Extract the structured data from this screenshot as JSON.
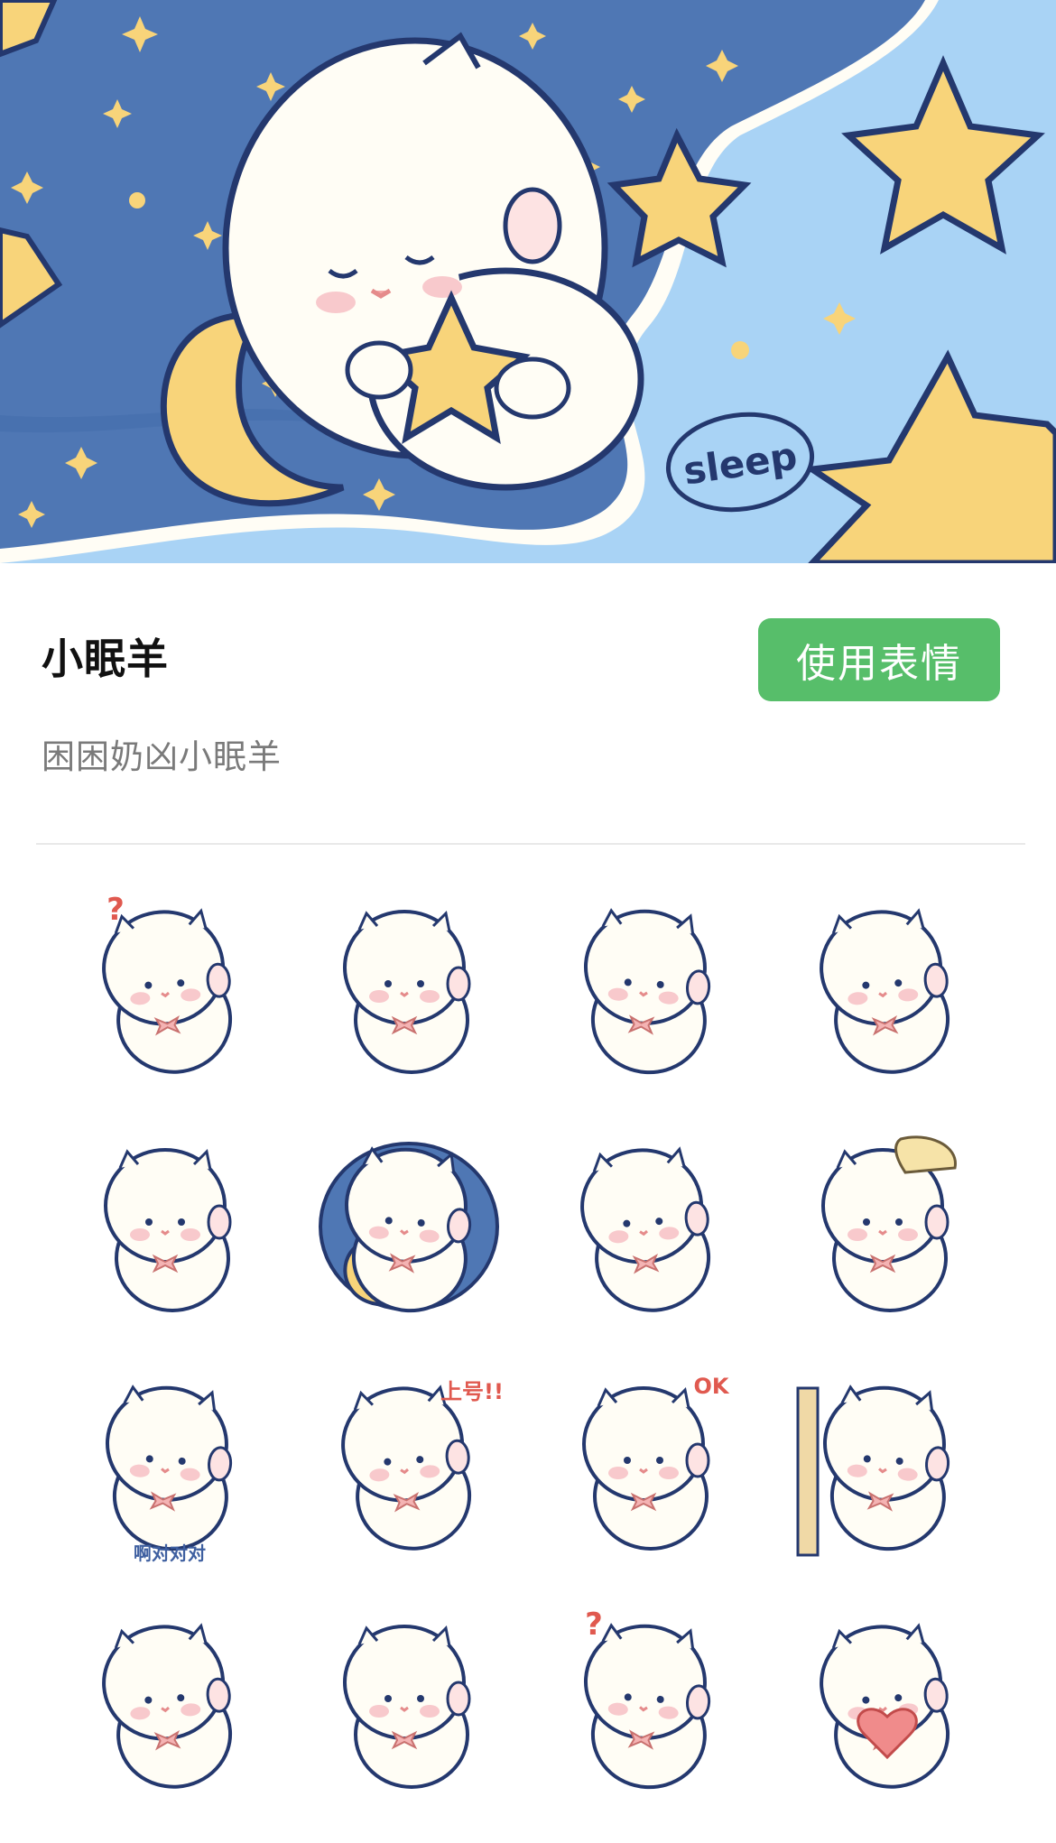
{
  "banner": {
    "sleep_text": "sleep",
    "colors": {
      "night": "#4f77b4",
      "sky": "#a9d3f5",
      "star": "#f8d47a",
      "outline": "#24386e",
      "wool": "#fffdf5"
    }
  },
  "pack": {
    "title": "小眠羊",
    "subtitle": "困困奶凶小眠羊",
    "use_button": "使用表情",
    "button_color": "#57be6a"
  },
  "stickers": [
    {
      "id": "confused",
      "mark": "?"
    },
    {
      "id": "knife",
      "mark": ""
    },
    {
      "id": "wink",
      "mark": ""
    },
    {
      "id": "grin",
      "mark": ""
    },
    {
      "id": "sweat",
      "mark": ""
    },
    {
      "id": "sleep-moon",
      "mark": ""
    },
    {
      "id": "cover-mouth",
      "mark": ""
    },
    {
      "id": "sign",
      "mark": ""
    },
    {
      "id": "yes-yes",
      "mark": "啊对对对"
    },
    {
      "id": "megaphone",
      "mark": "上号!!"
    },
    {
      "id": "ok",
      "mark": "OK"
    },
    {
      "id": "peek",
      "mark": ""
    },
    {
      "id": "turn-away",
      "mark": ""
    },
    {
      "id": "camera",
      "mark": ""
    },
    {
      "id": "phone",
      "mark": "?"
    },
    {
      "id": "broken-heart",
      "mark": ""
    }
  ]
}
